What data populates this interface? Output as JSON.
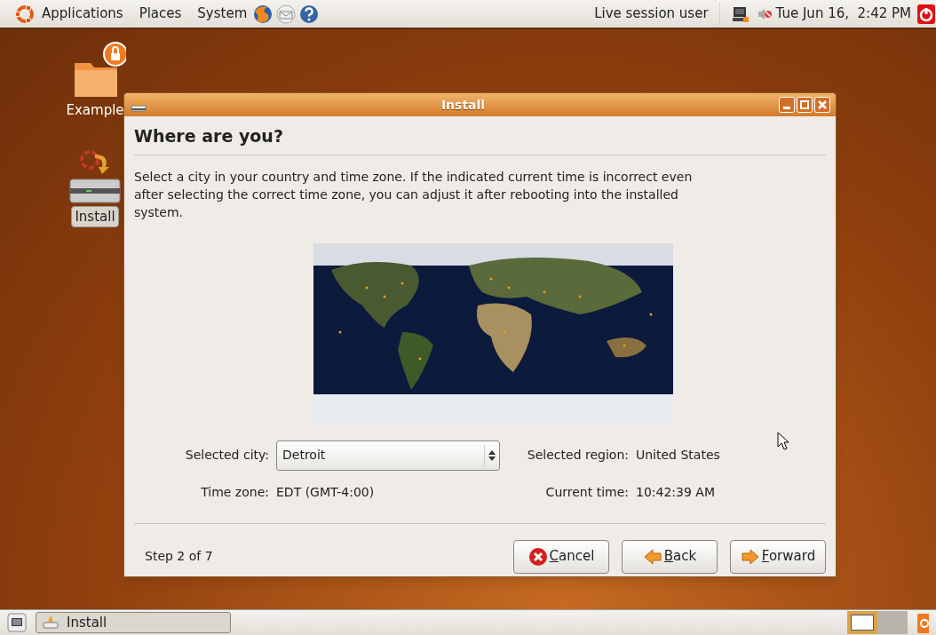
{
  "top_panel": {
    "menus": [
      "Applications",
      "Places",
      "System"
    ],
    "user": "Live session user",
    "clock": "Tue Jun 16,  2:42 PM"
  },
  "desktop_icons": [
    {
      "label": "Example",
      "selected": false
    },
    {
      "label": "Install",
      "selected": true
    }
  ],
  "window": {
    "title": "Install",
    "heading": "Where are you?",
    "description": "Select a city in your country and time zone. If the indicated current time is incorrect even after selecting the correct time zone, you can adjust it after rebooting into the installed system.",
    "city_label": "Selected city:",
    "city": "Detroit",
    "region_label": "Selected region:",
    "region": "United States",
    "timezone_label": "Time zone:",
    "timezone": "EDT (GMT-4:00)",
    "time_label": "Current time:",
    "time": "10:42:39 AM",
    "step": "Step 2 of 7",
    "buttons": [
      {
        "kind": "cancel",
        "label": "Cancel"
      },
      {
        "kind": "back",
        "label": "Back"
      },
      {
        "kind": "forward",
        "label": "Forward"
      }
    ]
  },
  "taskbar": {
    "tasks": [
      {
        "label": "Install"
      }
    ]
  }
}
